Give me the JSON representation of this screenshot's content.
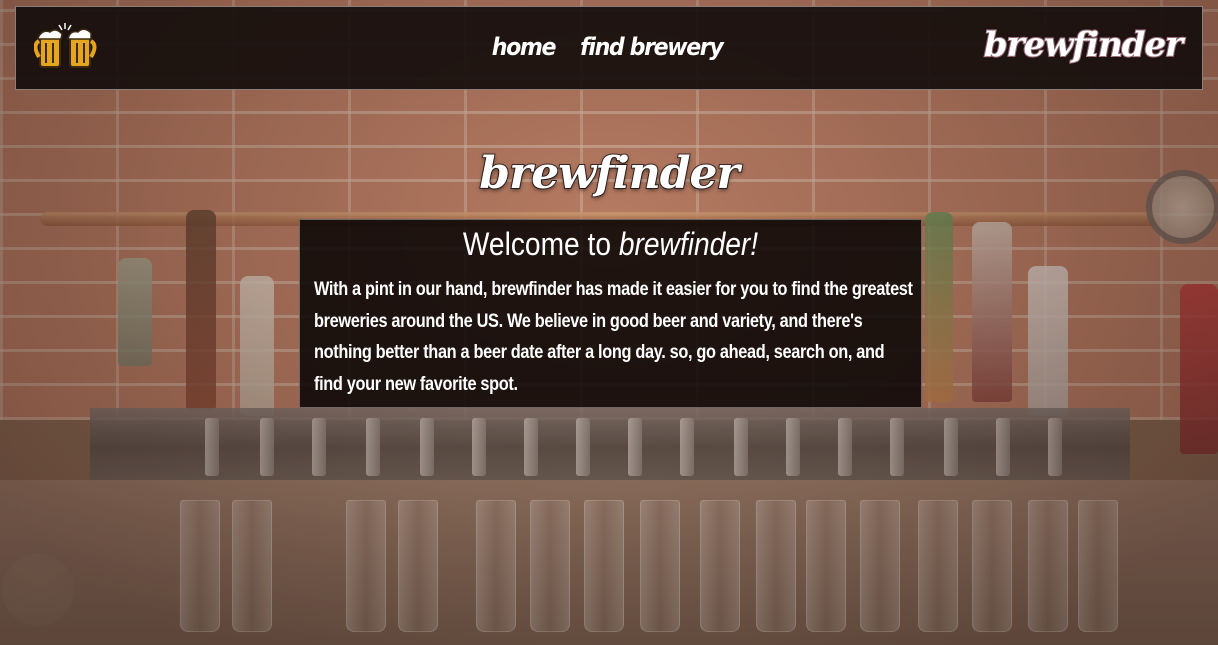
{
  "nav": {
    "logo_icon": "beer-mugs-icon",
    "links": [
      {
        "label": "home"
      },
      {
        "label": "find brewery"
      }
    ],
    "brand": "brewfinder"
  },
  "hero": {
    "brand": "brewfinder",
    "welcome_title_prefix": "Welcome to ",
    "welcome_title_emphasis": "brewfinder!",
    "welcome_body": "With a pint in our hand, brewfinder has made it easier for you to find the greatest breweries around the US. We believe in good beer and variety, and there's nothing better than a beer date after a long day. so, go ahead, search on, and find your new favorite spot."
  },
  "colors": {
    "nav_background": "#160e0c",
    "panel_background": "#0a0605",
    "text": "#ffffff",
    "beer_amber": "#e5a51e"
  }
}
